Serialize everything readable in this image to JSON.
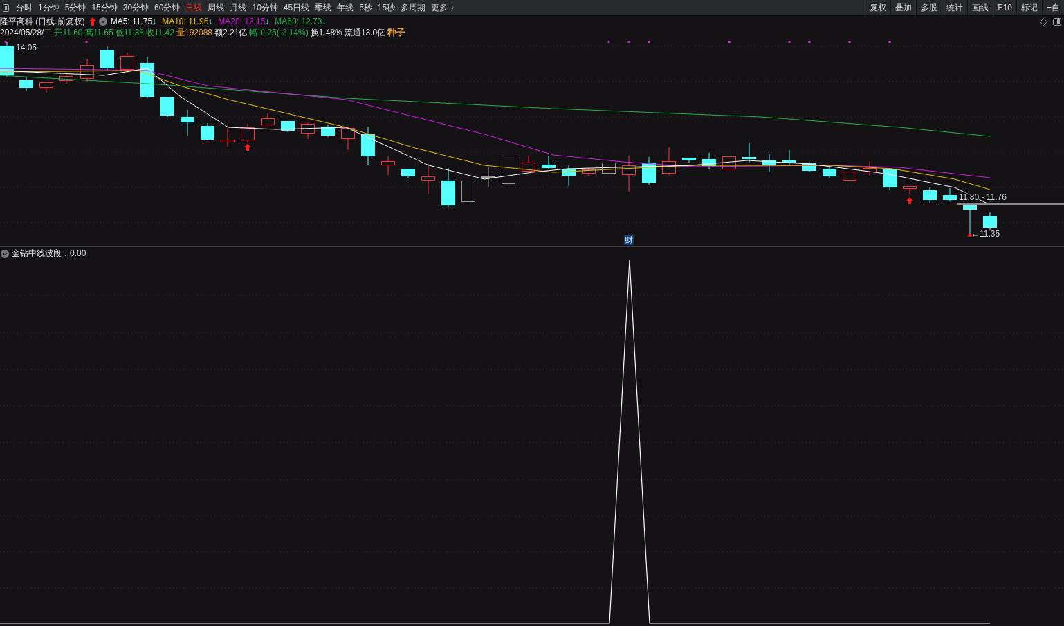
{
  "toolbar": {
    "periods": [
      {
        "label": "分时",
        "selected": false
      },
      {
        "label": "1分钟",
        "selected": false
      },
      {
        "label": "5分钟",
        "selected": false
      },
      {
        "label": "15分钟",
        "selected": false
      },
      {
        "label": "30分钟",
        "selected": false
      },
      {
        "label": "60分钟",
        "selected": false
      },
      {
        "label": "日线",
        "selected": true
      },
      {
        "label": "周线",
        "selected": false
      },
      {
        "label": "月线",
        "selected": false
      },
      {
        "label": "10分钟",
        "selected": false
      },
      {
        "label": "45日线",
        "selected": false
      },
      {
        "label": "季线",
        "selected": false
      },
      {
        "label": "年线",
        "selected": false
      },
      {
        "label": "5秒",
        "selected": false
      },
      {
        "label": "15秒",
        "selected": false
      },
      {
        "label": "多周期",
        "selected": false
      },
      {
        "label": "更多 〉",
        "selected": false
      }
    ],
    "tools": [
      "复权",
      "叠加",
      "多股",
      "统计",
      "画线",
      "F10",
      "标记",
      "+自"
    ]
  },
  "header": {
    "title": "隆平高科 (日线.前复权)",
    "moving_averages": [
      {
        "label": "MA5: 11.75",
        "arrow": "↓",
        "color": "#ffffff"
      },
      {
        "label": "MA10: 11.96",
        "arrow": "↓",
        "color": "#e6c200"
      },
      {
        "label": "MA20: 12.15",
        "arrow": "↓",
        "color": "#d21ee6"
      },
      {
        "label": "MA60: 12.73",
        "arrow": "↓",
        "color": "#22b24a"
      }
    ],
    "quote": [
      {
        "text": "2024/05/28/二",
        "color": "#e6e6e6"
      },
      {
        "text": "开11.60",
        "color": "#22b24a"
      },
      {
        "text": "高11.65",
        "color": "#22b24a"
      },
      {
        "text": "低11.38",
        "color": "#22b24a"
      },
      {
        "text": "收11.42",
        "color": "#22b24a"
      },
      {
        "text": "量192088",
        "color": "#f0a83c"
      },
      {
        "text": "额2.21亿",
        "color": "#e6e6e6"
      },
      {
        "text": "幅-0.25(-2.14%)",
        "color": "#22b24a"
      },
      {
        "text": "换1.48%",
        "color": "#e6e6e6"
      },
      {
        "text": "流通13.0亿",
        "color": "#e6e6e6"
      },
      {
        "text": "种子",
        "color": "#f0a83c",
        "kind": "tag"
      }
    ]
  },
  "chart": {
    "high_label": "14.05",
    "range_label": "11.80 - 11.76",
    "low_label": "←11.35",
    "badge": "财"
  },
  "indicator": {
    "label": "金钻中线波段：0.00"
  }
}
